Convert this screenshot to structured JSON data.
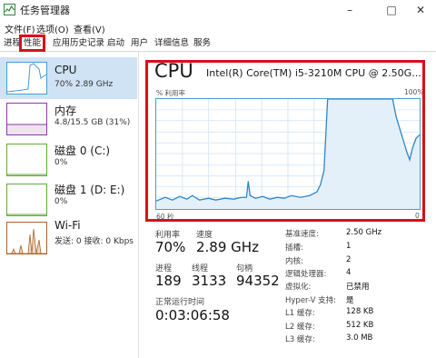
{
  "window": {
    "title": "任务管理器"
  },
  "menu": [
    "文件(F)",
    "选项(O)",
    "查看(V)"
  ],
  "tabs": [
    "进程",
    "性能",
    "应用历史记录",
    "启动",
    "用户",
    "详细信息",
    "服务"
  ],
  "sidebar": [
    {
      "name": "CPU",
      "sub": "70% 2.89 GHz"
    },
    {
      "name": "内存",
      "sub": "4.8/15.5 GB (31%)"
    },
    {
      "name": "磁盘 0 (C:)",
      "sub": "0%"
    },
    {
      "name": "磁盘 1 (D: E:)",
      "sub": "0%"
    },
    {
      "name": "Wi-Fi",
      "sub": "发送: 0 接收: 0 Kbps"
    }
  ],
  "main": {
    "title": "CPU",
    "model": "Intel(R) Core(TM) i5-3210M CPU @ 2.50G...",
    "graph_ylabel": "% 利用率",
    "graph_ymax": "100%",
    "graph_xlabel": "60 秒",
    "graph_xmin": "0",
    "util_label": "利用率",
    "util_value": "70%",
    "speed_label": "速度",
    "speed_value": "2.89 GHz",
    "proc_label": "进程",
    "proc_value": "189",
    "thread_label": "线程",
    "thread_value": "3133",
    "handle_label": "句柄",
    "handle_value": "94352",
    "uptime_label": "正常运行时间",
    "uptime_value": "0:03:06:58"
  },
  "info": [
    {
      "label": "基准速度:",
      "value": "2.50 GHz"
    },
    {
      "label": "插槽:",
      "value": "1"
    },
    {
      "label": "内核:",
      "value": "2"
    },
    {
      "label": "逻辑处理器:",
      "value": "4"
    },
    {
      "label": "虚拟化:",
      "value": "已禁用"
    },
    {
      "label": "Hyper-V 支持:",
      "value": "是"
    },
    {
      "label": "L1 缓存:",
      "value": "128 KB"
    },
    {
      "label": "L2 缓存:",
      "value": "512 KB"
    },
    {
      "label": "L3 缓存:",
      "value": "3.0 MB"
    }
  ],
  "colors": {
    "highlight": "#d90f17",
    "cpu": "#4a9bd2",
    "memory": "#8b3aa6",
    "disk": "#5fa83b",
    "network": "#a8632b"
  }
}
